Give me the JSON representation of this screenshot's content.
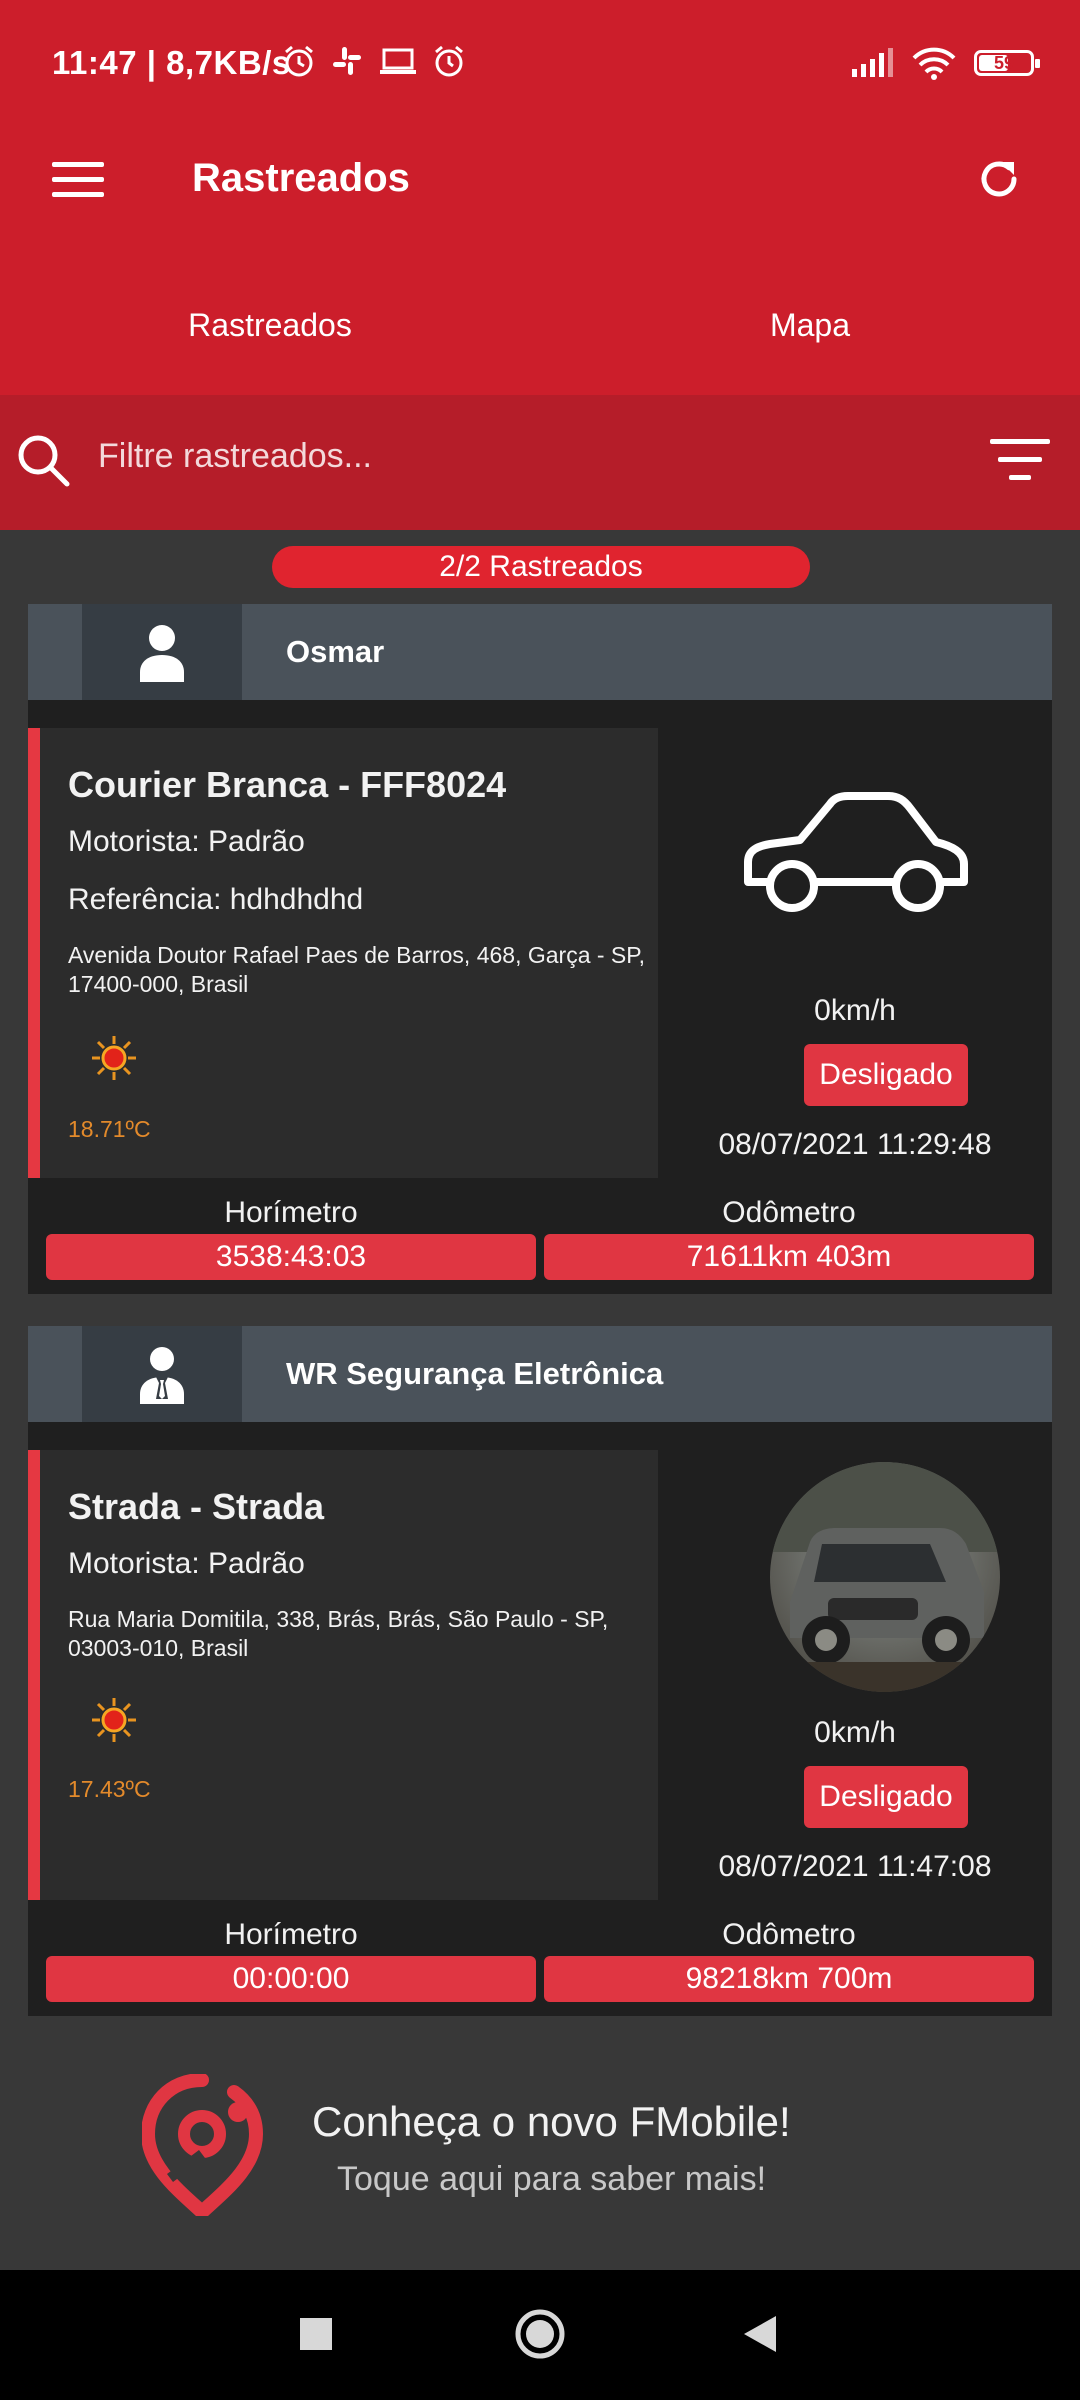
{
  "status_bar": {
    "time_speed": "11:47 | 8,7KB/s",
    "battery": "59",
    "icons": [
      "alarm-clock-icon",
      "slack-icon",
      "laptop-icon",
      "alarm-icon",
      "signal-icon",
      "wifi-icon",
      "battery-icon"
    ]
  },
  "app_bar": {
    "title": "Rastreados"
  },
  "tabs": [
    {
      "label": "Rastreados",
      "active": true
    },
    {
      "label": "Mapa",
      "active": false
    }
  ],
  "search": {
    "placeholder": "Filtre rastreados..."
  },
  "count": "2/2 Rastreados",
  "trackers": [
    {
      "owner": "Osmar",
      "vehicle": "Courier Branca - FFF8024",
      "driver": "Motorista: Padrão",
      "reference": "Referência: hdhdhdhd",
      "address": "Avenida Doutor Rafael Paes de Barros, 468, Garça - SP, 17400-000, Brasil",
      "temperature": "18.71ºC",
      "speed": "0km/h",
      "status": "Desligado",
      "timestamp": "08/07/2021 11:29:48",
      "hourmeter_label": "Horímetro",
      "hourmeter": "3538:43:03",
      "odometer_label": "Odômetro",
      "odometer": "71611km 403m"
    },
    {
      "owner": "WR Segurança Eletrônica",
      "vehicle": "Strada - Strada",
      "driver": "Motorista: Padrão",
      "address": "Rua Maria Domitila, 338, Brás, Brás, São Paulo - SP, 03003-010, Brasil",
      "temperature": "17.43ºC",
      "speed": "0km/h",
      "status": "Desligado",
      "timestamp": "08/07/2021 11:47:08",
      "hourmeter_label": "Horímetro",
      "hourmeter": "00:00:00",
      "odometer_label": "Odômetro",
      "odometer": "98218km 700m"
    }
  ],
  "promo": {
    "title": "Conheça o novo FMobile!",
    "subtitle": "Toque aqui para saber mais!"
  },
  "colors": {
    "primary": "#cc1e2b",
    "accent": "#e03642",
    "card_bg": "#1f1f1f",
    "temp": "#e38a2b"
  }
}
